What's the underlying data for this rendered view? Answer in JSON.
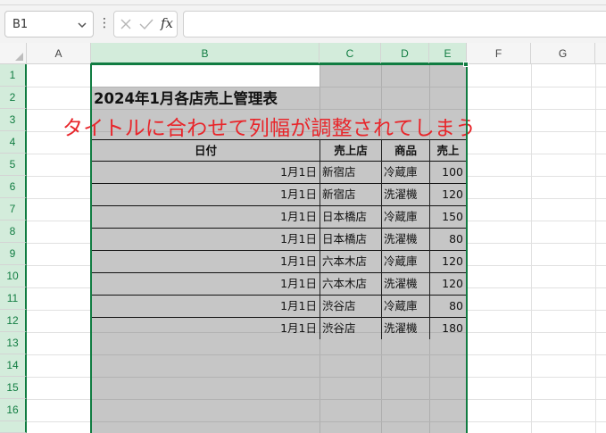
{
  "formula_bar": {
    "name_box": "B1",
    "fx_label": "fx",
    "formula": ""
  },
  "columns": [
    "A",
    "B",
    "C",
    "D",
    "E",
    "F",
    "G"
  ],
  "rows": [
    "1",
    "2",
    "3",
    "4",
    "5",
    "6",
    "7",
    "8",
    "9",
    "10",
    "11",
    "12",
    "13",
    "14",
    "15",
    "16"
  ],
  "sheet": {
    "title": "2024年1月各店売上管理表",
    "table_headers": [
      "日付",
      "売上店",
      "商品",
      "売上"
    ],
    "table_rows": [
      [
        "1月1日",
        "新宿店",
        "冷蔵庫",
        "100"
      ],
      [
        "1月1日",
        "新宿店",
        "洗濯機",
        "120"
      ],
      [
        "1月1日",
        "日本橋店",
        "冷蔵庫",
        "150"
      ],
      [
        "1月1日",
        "日本橋店",
        "洗濯機",
        "80"
      ],
      [
        "1月1日",
        "六本木店",
        "冷蔵庫",
        "120"
      ],
      [
        "1月1日",
        "六本木店",
        "洗濯機",
        "120"
      ],
      [
        "1月1日",
        "渋谷店",
        "冷蔵庫",
        "80"
      ],
      [
        "1月1日",
        "渋谷店",
        "洗濯機",
        "180"
      ]
    ]
  },
  "annotation": "タイトルに合わせて列幅が調整されてしまう",
  "colors": {
    "selection_accent": "#107c41",
    "annotation": "#e8262b",
    "selected_fill": "#c6c6c6"
  }
}
